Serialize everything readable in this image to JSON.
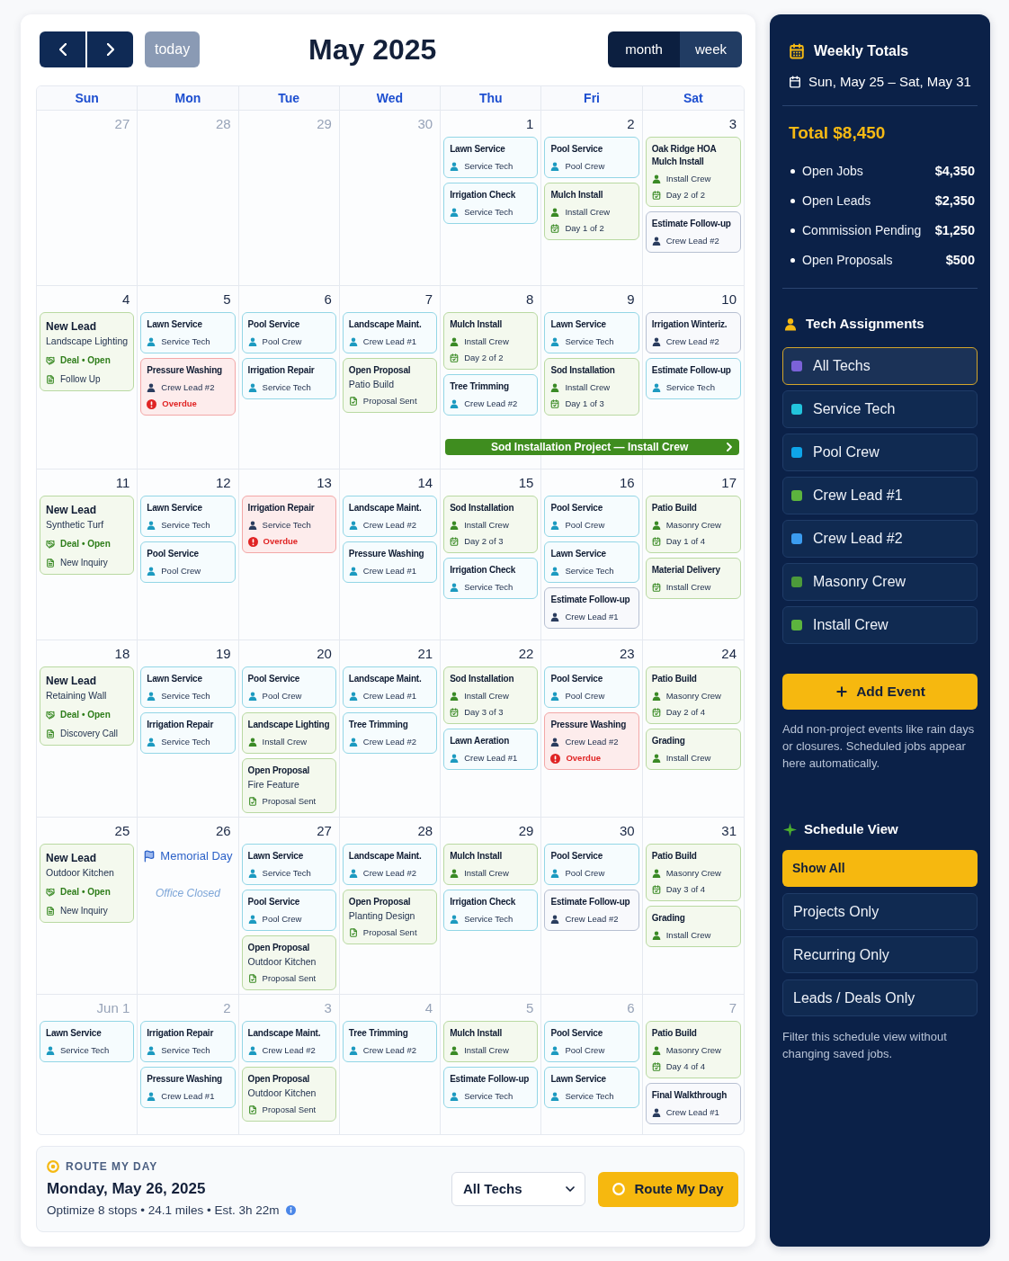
{
  "header": {
    "today": "today",
    "title": "May 2025",
    "views": [
      {
        "label": "month",
        "selected": true
      },
      {
        "label": "week",
        "selected": false
      }
    ]
  },
  "weekdays": [
    "Sun",
    "Mon",
    "Tue",
    "Wed",
    "Thu",
    "Fri",
    "Sat"
  ],
  "weeks": [
    {
      "days": [
        {
          "date": "27",
          "muted": true
        },
        {
          "date": "28",
          "muted": true
        },
        {
          "date": "29",
          "muted": true
        },
        {
          "date": "30",
          "muted": true
        },
        {
          "date": "1",
          "muted": false,
          "events": [
            {
              "kind": "service",
              "title": "Lawn Service",
              "lines": [
                {
                  "kind": "crew",
                  "text": "Service Tech"
                }
              ]
            },
            {
              "kind": "service",
              "title": "Irrigation Check",
              "lines": [
                {
                  "kind": "crew",
                  "text": "Service Tech"
                }
              ]
            }
          ]
        },
        {
          "date": "2",
          "muted": false,
          "events": [
            {
              "kind": "service",
              "title": "Pool Service",
              "lines": [
                {
                  "kind": "crew",
                  "text": "Pool Crew"
                }
              ]
            },
            {
              "kind": "project",
              "title": "Mulch Install",
              "lines": [
                {
                  "kind": "crew",
                  "text": "Install Crew"
                },
                {
                  "kind": "day",
                  "text": "Day 1 of 2"
                }
              ]
            }
          ]
        },
        {
          "date": "3",
          "muted": false,
          "events": [
            {
              "kind": "project",
              "title": "Oak Ridge HOA Mulch Install",
              "lines": [
                {
                  "kind": "crew",
                  "text": "Install Crew"
                },
                {
                  "kind": "day",
                  "text": "Day 2 of 2"
                }
              ]
            },
            {
              "kind": "task",
              "title": "Estimate Follow-up",
              "lines": [
                {
                  "kind": "crew",
                  "text": "Crew Lead #2"
                }
              ]
            }
          ]
        }
      ]
    },
    {
      "days": [
        {
          "date": "4",
          "muted": false,
          "events": [
            {
              "kind": "lead",
              "title": "New Lead",
              "subtitle": "Landscape Lighting",
              "lines": [
                {
                  "kind": "deal",
                  "text": "Deal • Open"
                },
                {
                  "kind": "note",
                  "text": "Follow Up"
                }
              ]
            }
          ]
        },
        {
          "date": "5",
          "muted": false,
          "events": [
            {
              "kind": "service",
              "title": "Lawn Service",
              "lines": [
                {
                  "kind": "crew",
                  "text": "Service Tech"
                }
              ]
            },
            {
              "kind": "overdue",
              "title": "Pressure Washing",
              "lines": [
                {
                  "kind": "crew",
                  "text": "Crew Lead #2"
                },
                {
                  "kind": "overdue",
                  "text": "Overdue"
                }
              ]
            }
          ]
        },
        {
          "date": "6",
          "muted": false,
          "events": [
            {
              "kind": "service",
              "title": "Pool Service",
              "lines": [
                {
                  "kind": "crew",
                  "text": "Pool Crew"
                }
              ]
            },
            {
              "kind": "service",
              "title": "Irrigation Repair",
              "lines": [
                {
                  "kind": "crew",
                  "text": "Service Tech"
                }
              ]
            }
          ]
        },
        {
          "date": "7",
          "muted": false,
          "events": [
            {
              "kind": "service",
              "title": "Landscape Maint.",
              "lines": [
                {
                  "kind": "crew",
                  "text": "Crew Lead #1"
                }
              ]
            },
            {
              "kind": "proposal",
              "title": "Open Proposal",
              "subtitle": "Patio Build",
              "lines": [
                {
                  "kind": "proposal",
                  "text": "Proposal Sent"
                }
              ]
            }
          ]
        },
        {
          "date": "8",
          "muted": false,
          "project_bar": {
            "label": "Sod Installation Project — Install Crew"
          },
          "events": [
            {
              "kind": "project",
              "title": "Mulch Install",
              "lines": [
                {
                  "kind": "crew",
                  "text": "Install Crew"
                },
                {
                  "kind": "day",
                  "text": "Day 2 of 2"
                }
              ]
            },
            {
              "kind": "service",
              "title": "Tree Trimming",
              "lines": [
                {
                  "kind": "crew",
                  "text": "Crew Lead #2"
                }
              ]
            }
          ]
        },
        {
          "date": "9",
          "muted": false,
          "events": [
            {
              "kind": "service",
              "title": "Lawn Service",
              "lines": [
                {
                  "kind": "crew",
                  "text": "Service Tech"
                }
              ]
            },
            {
              "kind": "project",
              "title": "Sod Installation",
              "lines": [
                {
                  "kind": "crew",
                  "text": "Install Crew"
                },
                {
                  "kind": "day",
                  "text": "Day 1 of 3"
                }
              ]
            }
          ]
        },
        {
          "date": "10",
          "muted": false,
          "events": [
            {
              "kind": "task",
              "title": "Irrigation Winteriz.",
              "lines": [
                {
                  "kind": "crew",
                  "text": "Crew Lead #2"
                }
              ]
            },
            {
              "kind": "service",
              "title": "Estimate Follow-up",
              "lines": [
                {
                  "kind": "crew",
                  "text": "Service Tech"
                }
              ]
            }
          ]
        }
      ]
    },
    {
      "days": [
        {
          "date": "11",
          "muted": false,
          "events": [
            {
              "kind": "lead",
              "title": "New Lead",
              "subtitle": "Synthetic Turf",
              "lines": [
                {
                  "kind": "deal",
                  "text": "Deal • Open"
                },
                {
                  "kind": "note",
                  "text": "New Inquiry"
                }
              ]
            }
          ]
        },
        {
          "date": "12",
          "muted": false,
          "events": [
            {
              "kind": "service",
              "title": "Lawn Service",
              "lines": [
                {
                  "kind": "crew",
                  "text": "Service Tech"
                }
              ]
            },
            {
              "kind": "service",
              "title": "Pool Service",
              "lines": [
                {
                  "kind": "crew",
                  "text": "Pool Crew"
                }
              ]
            }
          ]
        },
        {
          "date": "13",
          "muted": false,
          "events": [
            {
              "kind": "overdue",
              "title": "Irrigation Repair",
              "lines": [
                {
                  "kind": "crew",
                  "text": "Service Tech"
                },
                {
                  "kind": "overdue",
                  "text": "Overdue"
                }
              ]
            }
          ]
        },
        {
          "date": "14",
          "muted": false,
          "events": [
            {
              "kind": "service",
              "title": "Landscape Maint.",
              "lines": [
                {
                  "kind": "crew",
                  "text": "Crew Lead #2"
                }
              ]
            },
            {
              "kind": "service",
              "title": "Pressure Washing",
              "lines": [
                {
                  "kind": "crew",
                  "text": "Crew Lead #1"
                }
              ]
            }
          ]
        },
        {
          "date": "15",
          "muted": false,
          "events": [
            {
              "kind": "project",
              "title": "Sod Installation",
              "lines": [
                {
                  "kind": "crew",
                  "text": "Install Crew"
                },
                {
                  "kind": "day",
                  "text": "Day 2 of 3"
                }
              ]
            },
            {
              "kind": "service",
              "title": "Irrigation Check",
              "lines": [
                {
                  "kind": "crew",
                  "text": "Service Tech"
                }
              ]
            }
          ]
        },
        {
          "date": "16",
          "muted": false,
          "events": [
            {
              "kind": "service",
              "title": "Pool Service",
              "lines": [
                {
                  "kind": "crew",
                  "text": "Pool Crew"
                }
              ]
            },
            {
              "kind": "service",
              "title": "Lawn Service",
              "lines": [
                {
                  "kind": "crew",
                  "text": "Service Tech"
                }
              ]
            },
            {
              "kind": "task",
              "title": "Estimate Follow-up",
              "lines": [
                {
                  "kind": "crew",
                  "text": "Crew Lead #1"
                }
              ]
            }
          ]
        },
        {
          "date": "17",
          "muted": false,
          "events": [
            {
              "kind": "project",
              "title": "Patio Build",
              "lines": [
                {
                  "kind": "crew",
                  "text": "Masonry Crew"
                },
                {
                  "kind": "day",
                  "text": "Day 1 of 4"
                }
              ]
            },
            {
              "kind": "project",
              "title": "Material Delivery",
              "lines": [
                {
                  "kind": "day",
                  "text": "Install Crew"
                }
              ]
            }
          ]
        }
      ]
    },
    {
      "days": [
        {
          "date": "18",
          "muted": false,
          "events": [
            {
              "kind": "lead",
              "title": "New Lead",
              "subtitle": "Retaining Wall",
              "lines": [
                {
                  "kind": "deal",
                  "text": "Deal • Open"
                },
                {
                  "kind": "note",
                  "text": "Discovery Call"
                }
              ]
            }
          ]
        },
        {
          "date": "19",
          "muted": false,
          "events": [
            {
              "kind": "service",
              "title": "Lawn Service",
              "lines": [
                {
                  "kind": "crew",
                  "text": "Service Tech"
                }
              ]
            },
            {
              "kind": "service",
              "title": "Irrigation Repair",
              "lines": [
                {
                  "kind": "crew",
                  "text": "Service Tech"
                }
              ]
            }
          ]
        },
        {
          "date": "20",
          "muted": false,
          "events": [
            {
              "kind": "service",
              "title": "Pool Service",
              "lines": [
                {
                  "kind": "crew",
                  "text": "Pool Crew"
                }
              ]
            },
            {
              "kind": "project",
              "title": "Landscape Lighting",
              "lines": [
                {
                  "kind": "crew",
                  "text": "Install Crew"
                }
              ]
            },
            {
              "kind": "proposal",
              "title": "Open Proposal",
              "subtitle": "Fire Feature",
              "lines": [
                {
                  "kind": "proposal",
                  "text": "Proposal Sent"
                }
              ]
            }
          ]
        },
        {
          "date": "21",
          "muted": false,
          "events": [
            {
              "kind": "service",
              "title": "Landscape Maint.",
              "lines": [
                {
                  "kind": "crew",
                  "text": "Crew Lead #1"
                }
              ]
            },
            {
              "kind": "service",
              "title": "Tree Trimming",
              "lines": [
                {
                  "kind": "crew",
                  "text": "Crew Lead #2"
                }
              ]
            }
          ]
        },
        {
          "date": "22",
          "muted": false,
          "events": [
            {
              "kind": "project",
              "title": "Sod Installation",
              "lines": [
                {
                  "kind": "crew",
                  "text": "Install Crew"
                },
                {
                  "kind": "day",
                  "text": "Day 3 of 3"
                }
              ]
            },
            {
              "kind": "service",
              "title": "Lawn Aeration",
              "lines": [
                {
                  "kind": "crew",
                  "text": "Crew Lead #1"
                }
              ]
            }
          ]
        },
        {
          "date": "23",
          "muted": false,
          "events": [
            {
              "kind": "service",
              "title": "Pool Service",
              "lines": [
                {
                  "kind": "crew",
                  "text": "Pool Crew"
                }
              ]
            },
            {
              "kind": "overdue",
              "title": "Pressure Washing",
              "lines": [
                {
                  "kind": "crew",
                  "text": "Crew Lead #2"
                },
                {
                  "kind": "overdue",
                  "text": "Overdue"
                }
              ]
            }
          ]
        },
        {
          "date": "24",
          "muted": false,
          "events": [
            {
              "kind": "project",
              "title": "Patio Build",
              "lines": [
                {
                  "kind": "crew",
                  "text": "Masonry Crew"
                },
                {
                  "kind": "day",
                  "text": "Day 2 of 4"
                }
              ]
            },
            {
              "kind": "project",
              "title": "Grading",
              "lines": [
                {
                  "kind": "crew",
                  "text": "Install Crew"
                }
              ]
            }
          ]
        }
      ]
    },
    {
      "days": [
        {
          "date": "25",
          "muted": false,
          "events": [
            {
              "kind": "lead",
              "title": "New Lead",
              "subtitle": "Outdoor Kitchen",
              "lines": [
                {
                  "kind": "deal",
                  "text": "Deal • Open"
                },
                {
                  "kind": "note",
                  "text": "New Inquiry"
                }
              ]
            }
          ]
        },
        {
          "date": "26",
          "muted": false,
          "holiday": {
            "name": "Memorial Day",
            "note": "Office Closed"
          }
        },
        {
          "date": "27",
          "muted": false,
          "events": [
            {
              "kind": "service",
              "title": "Lawn Service",
              "lines": [
                {
                  "kind": "crew",
                  "text": "Service Tech"
                }
              ]
            },
            {
              "kind": "service",
              "title": "Pool Service",
              "lines": [
                {
                  "kind": "crew",
                  "text": "Pool Crew"
                }
              ]
            },
            {
              "kind": "proposal",
              "title": "Open Proposal",
              "subtitle": "Outdoor Kitchen",
              "lines": [
                {
                  "kind": "proposal",
                  "text": "Proposal Sent"
                }
              ]
            }
          ]
        },
        {
          "date": "28",
          "muted": false,
          "events": [
            {
              "kind": "service",
              "title": "Landscape Maint.",
              "lines": [
                {
                  "kind": "crew",
                  "text": "Crew Lead #2"
                }
              ]
            },
            {
              "kind": "proposal",
              "title": "Open Proposal",
              "subtitle": "Planting Design",
              "lines": [
                {
                  "kind": "proposal",
                  "text": "Proposal Sent"
                }
              ]
            }
          ]
        },
        {
          "date": "29",
          "muted": false,
          "events": [
            {
              "kind": "project",
              "title": "Mulch Install",
              "lines": [
                {
                  "kind": "crew",
                  "text": "Install Crew"
                }
              ]
            },
            {
              "kind": "service",
              "title": "Irrigation Check",
              "lines": [
                {
                  "kind": "crew",
                  "text": "Service Tech"
                }
              ]
            }
          ]
        },
        {
          "date": "30",
          "muted": false,
          "events": [
            {
              "kind": "service",
              "title": "Pool Service",
              "lines": [
                {
                  "kind": "crew",
                  "text": "Pool Crew"
                }
              ]
            },
            {
              "kind": "task",
              "title": "Estimate Follow-up",
              "lines": [
                {
                  "kind": "crew",
                  "text": "Crew Lead #2"
                }
              ]
            }
          ]
        },
        {
          "date": "31",
          "muted": false,
          "events": [
            {
              "kind": "project",
              "title": "Patio Build",
              "lines": [
                {
                  "kind": "crew",
                  "text": "Masonry Crew"
                },
                {
                  "kind": "day",
                  "text": "Day 3 of 4"
                }
              ]
            },
            {
              "kind": "project",
              "title": "Grading",
              "lines": [
                {
                  "kind": "crew",
                  "text": "Install Crew"
                }
              ]
            }
          ]
        }
      ]
    },
    {
      "days": [
        {
          "date": "Jun 1",
          "muted": true,
          "events": [
            {
              "kind": "service",
              "title": "Lawn Service",
              "lines": [
                {
                  "kind": "crew",
                  "text": "Service Tech"
                }
              ]
            }
          ]
        },
        {
          "date": "2",
          "muted": true,
          "events": [
            {
              "kind": "service",
              "title": "Irrigation Repair",
              "lines": [
                {
                  "kind": "crew",
                  "text": "Service Tech"
                }
              ]
            },
            {
              "kind": "service",
              "title": "Pressure Washing",
              "lines": [
                {
                  "kind": "crew",
                  "text": "Crew Lead #1"
                }
              ]
            }
          ]
        },
        {
          "date": "3",
          "muted": true,
          "events": [
            {
              "kind": "service",
              "title": "Landscape Maint.",
              "lines": [
                {
                  "kind": "crew",
                  "text": "Crew Lead #2"
                }
              ]
            },
            {
              "kind": "proposal",
              "title": "Open Proposal",
              "subtitle": "Outdoor Kitchen",
              "lines": [
                {
                  "kind": "proposal",
                  "text": "Proposal Sent"
                }
              ]
            }
          ]
        },
        {
          "date": "4",
          "muted": true,
          "events": [
            {
              "kind": "service",
              "title": "Tree Trimming",
              "lines": [
                {
                  "kind": "crew",
                  "text": "Crew Lead #2"
                }
              ]
            }
          ]
        },
        {
          "date": "5",
          "muted": true,
          "events": [
            {
              "kind": "project",
              "title": "Mulch Install",
              "lines": [
                {
                  "kind": "crew",
                  "text": "Install Crew"
                }
              ]
            },
            {
              "kind": "service",
              "title": "Estimate Follow-up",
              "lines": [
                {
                  "kind": "crew",
                  "text": "Service Tech"
                }
              ]
            }
          ]
        },
        {
          "date": "6",
          "muted": true,
          "events": [
            {
              "kind": "service",
              "title": "Pool Service",
              "lines": [
                {
                  "kind": "crew",
                  "text": "Pool Crew"
                }
              ]
            },
            {
              "kind": "service",
              "title": "Lawn Service",
              "lines": [
                {
                  "kind": "crew",
                  "text": "Service Tech"
                }
              ]
            }
          ]
        },
        {
          "date": "7",
          "muted": true,
          "events": [
            {
              "kind": "project",
              "title": "Patio Build",
              "lines": [
                {
                  "kind": "crew",
                  "text": "Masonry Crew"
                },
                {
                  "kind": "day",
                  "text": "Day 4 of 4"
                }
              ]
            },
            {
              "kind": "task",
              "title": "Final Walkthrough",
              "lines": [
                {
                  "kind": "crew",
                  "text": "Crew Lead #1"
                }
              ]
            }
          ]
        }
      ]
    }
  ],
  "route": {
    "label": "ROUTE MY DAY",
    "date": "Monday, May 26, 2025",
    "summary": "Optimize 8 stops • 24.1 miles • Est. 3h 22m",
    "tech_select": "All Techs",
    "button": "Route My Day"
  },
  "sidebar": {
    "weekly_totals": {
      "title": "Weekly Totals",
      "range": "Sun, May 25 – Sat, May 31",
      "total": "Total $8,450",
      "items": [
        {
          "label": "Open Jobs",
          "value": "$4,350"
        },
        {
          "label": "Open Leads",
          "value": "$2,350"
        },
        {
          "label": "Commission Pending",
          "value": "$1,250"
        },
        {
          "label": "Open Proposals",
          "value": "$500"
        }
      ]
    },
    "tech_assignments": {
      "title": "Tech Assignments",
      "items": [
        {
          "label": "All Techs",
          "color": "#7b62d8",
          "selected": true
        },
        {
          "label": "Service Tech",
          "color": "#22c4dc",
          "selected": false
        },
        {
          "label": "Pool Crew",
          "color": "#0ea5e9",
          "selected": false
        },
        {
          "label": "Crew Lead #1",
          "color": "#5cb43e",
          "selected": false
        },
        {
          "label": "Crew Lead #2",
          "color": "#3b9cf0",
          "selected": false
        },
        {
          "label": "Masonry Crew",
          "color": "#4c9a3a",
          "selected": false
        },
        {
          "label": "Install Crew",
          "color": "#5cb43e",
          "selected": false
        }
      ]
    },
    "add_event": {
      "label": "Add Event",
      "help": "Add non-project events like rain days or closures. Scheduled jobs appear here automatically."
    },
    "schedule_view": {
      "title": "Schedule View",
      "items": [
        {
          "label": "Show All",
          "selected": true
        },
        {
          "label": "Projects Only",
          "selected": false
        },
        {
          "label": "Recurring Only",
          "selected": false
        },
        {
          "label": "Leads / Deals Only",
          "selected": false
        }
      ],
      "help": "Filter this schedule view without changing saved jobs."
    }
  }
}
